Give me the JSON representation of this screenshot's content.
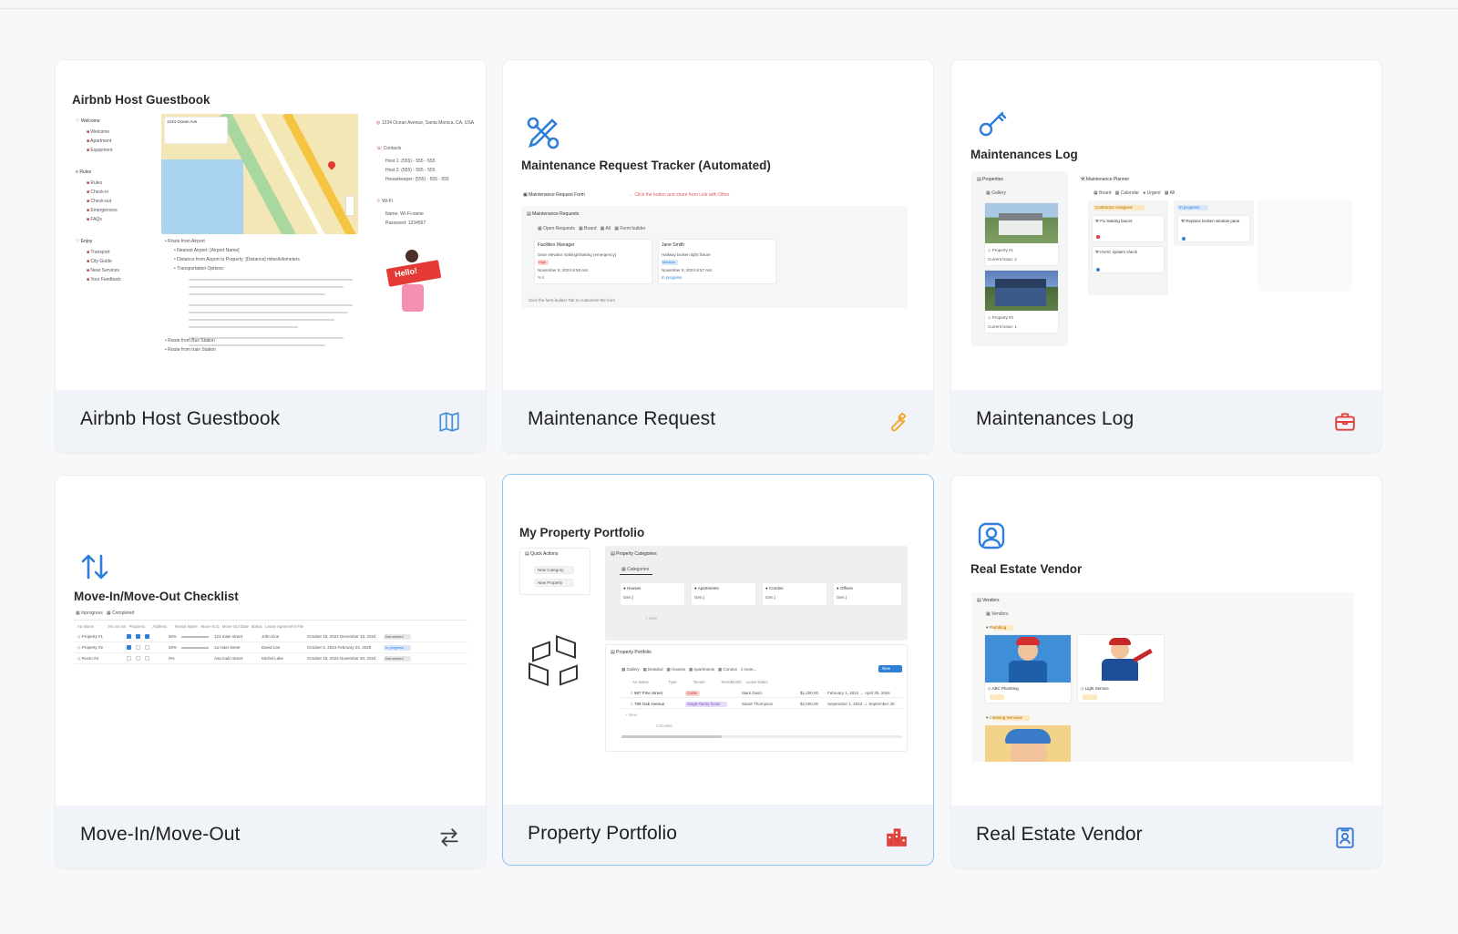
{
  "cards": [
    {
      "id": "airbnb",
      "label": "Airbnb Host Guestbook",
      "icon": "map-icon",
      "icon_color": "#4a90d9",
      "preview": {
        "title": "Airbnb Host Guestbook",
        "nav_sections": [
          "Welcome",
          "Rules",
          "Enjoy"
        ],
        "nav_items": [
          "Welcome",
          "Apartment",
          "Equipment",
          "Rules",
          "Check-in",
          "Check-out",
          "Emergencies",
          "FAQs",
          "Transport",
          "City Guide",
          "Near Services",
          "Your Feedback"
        ],
        "map_caption": "1234 Ocean Ave",
        "address": "1234 Ocean Avenue, Santa Monica, CA, USA",
        "contacts_title": "Contacts",
        "contacts": [
          "Host 1: (555) - 555 - 555",
          "Host 2: (555) - 555 - 555",
          "Housekeeper: (555) - 555 - 555"
        ],
        "wifi_title": "Wi-Fi",
        "wifi": [
          "Name: Wi-Fi-name",
          "Password: 1234567"
        ],
        "route_title": "Route from Airport",
        "route_items": [
          "Nearest Airport: [Airport Name]",
          "Distance from Airport to Property: [Distance] miles/kilometers",
          "Transportation Options:"
        ],
        "route_more": [
          "Route from Bus Station",
          "Route from train Station"
        ],
        "hello": "Hello!"
      }
    },
    {
      "id": "maintenance-request",
      "label": "Maintenance Request",
      "icon": "wrench-icon",
      "icon_color": "#f0a830",
      "preview": {
        "title": "Maintenance Request Tracker (Automated)",
        "form_label": "Maintenance Request Form",
        "form_hint": "← Click the button and share form Link with Other",
        "section": "Maintenance Requests",
        "tabs": [
          "Open Requests",
          "Board",
          "All",
          "Form builder"
        ],
        "cards": [
          {
            "name": "Facilities Manager",
            "desc": "Gear elevator making/shaking (emergency)",
            "tag": "High",
            "date": "November 8, 2024 8:58 AM",
            "status": "Not"
          },
          {
            "name": "Jane Smith",
            "desc": "Hallway broken light fixture",
            "tag": "Medium",
            "date": "November 8, 2024 8:57 AM",
            "status": "In progress"
          }
        ],
        "footer_hint": "Click the form builder Tab to customize the form"
      }
    },
    {
      "id": "maintenances-log",
      "label": "Maintenances Log",
      "icon": "toolbox-icon",
      "icon_color": "#e0403a",
      "preview": {
        "title": "Maintenances Log",
        "properties_label": "Properties",
        "gallery_tab": "Gallery",
        "properties": [
          {
            "name": "Property #1",
            "sub": "Current issue: 2"
          },
          {
            "name": "Property #2",
            "sub": "Current issue: 1"
          }
        ],
        "planner_label": "Maintenance Planner",
        "planner_tabs": [
          "Board",
          "Calendar",
          "Urgent",
          "All"
        ],
        "columns": [
          {
            "header": "Contractor Assigned",
            "items": [
              "Fix leaking faucet",
              "HVAC system check"
            ]
          },
          {
            "header": "In progress",
            "items": [
              "Replace broken window pane"
            ]
          }
        ]
      }
    },
    {
      "id": "move-in-out",
      "label": "Move-In/Move-Out",
      "icon": "swap-arrows-icon",
      "icon_color": "#444444",
      "preview": {
        "title": "Move-In/Move-Out Checklist",
        "tabs": [
          "Inprogress",
          "Completed"
        ],
        "headers": [
          "Aa Name",
          "Ins",
          "Ins",
          "Ins",
          "Progress",
          "Address",
          "Tenant Name",
          "Move-In D.",
          "Move-Out Date",
          "Status",
          "Lease Agreement File"
        ],
        "rows": [
          {
            "name": "Property #1",
            "progress": "60%",
            "address": "123 main street",
            "tenant": "John Doe",
            "dates": "October 15, 2024 December 15, 2024",
            "status": "Not started"
          },
          {
            "name": "Property #2",
            "progress": "20%",
            "address": "1a main street",
            "tenant": "David Lee",
            "dates": "October 6, 2024 February 24, 2025",
            "status": "In progress"
          },
          {
            "name": "Room #3",
            "progress": "0%",
            "address": "Asa main street",
            "tenant": "Michel Lake",
            "dates": "October 19, 2024 November 20, 2024",
            "status": "Not started"
          }
        ]
      }
    },
    {
      "id": "property-portfolio",
      "label": "Property Portfolio",
      "icon": "buildings-icon",
      "icon_color": "#e0403a",
      "preview": {
        "title": "My Property Portfolio",
        "quick_actions": "Quick Actions",
        "buttons": [
          "New Category",
          "New Property"
        ],
        "categories_label": "Property Categories",
        "categories_tab": "Categories",
        "categories": [
          "Houses",
          "Apartments",
          "Condos",
          "Offices"
        ],
        "category_count": "Gen.)",
        "new_label": "+ New",
        "portfolio_label": "Property Portfolio",
        "portfolio_tabs": [
          "Gallery",
          "Detailed",
          "Houses",
          "Apartments",
          "Condos",
          "1 more..."
        ],
        "new_button": "New",
        "table_headers": [
          "Aa Name",
          "Type",
          "Tenant",
          "Rent/Month",
          "Lease Dates"
        ],
        "rows": [
          {
            "name": "987 Pine Street",
            "type": "Cabin",
            "tenant": "Mark Davis",
            "rent": "$1,200.00",
            "lease": "February 1, 2024 → April 30, 2024"
          },
          {
            "name": "789 Oak Avenue",
            "type": "Single-family home",
            "tenant": "Sarah Thompson",
            "rent": "$2,000.00",
            "lease": "September 1, 2023 → September 30"
          }
        ],
        "calculate": "Calculate"
      }
    },
    {
      "id": "real-estate-vendor",
      "label": "Real Estate Vendor",
      "icon": "id-badge-icon",
      "icon_color": "#3a7bd5",
      "preview": {
        "title": "Real Estate Vendor",
        "vendors_label": "Vendors",
        "vendors_tab": "Vendors",
        "groups": [
          "Plumbing",
          "Cleaning Services"
        ],
        "vendors": [
          {
            "name": "ABC Plumbing"
          },
          {
            "name": "Light Service"
          }
        ]
      }
    }
  ]
}
